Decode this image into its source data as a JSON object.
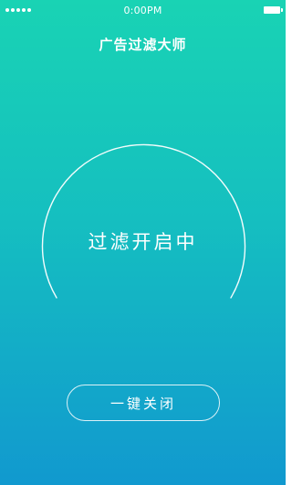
{
  "status_bar": {
    "time": "0:00PM",
    "signal_icon": "signal-dots-icon",
    "battery_icon": "battery-icon"
  },
  "app": {
    "title": "广告过滤大师"
  },
  "filter": {
    "status_text": "过滤开启中"
  },
  "actions": {
    "close_label": "一键关闭"
  },
  "colors": {
    "gradient_top": "#19d3b4",
    "gradient_bottom": "#1199cf",
    "foreground": "#ffffff"
  }
}
